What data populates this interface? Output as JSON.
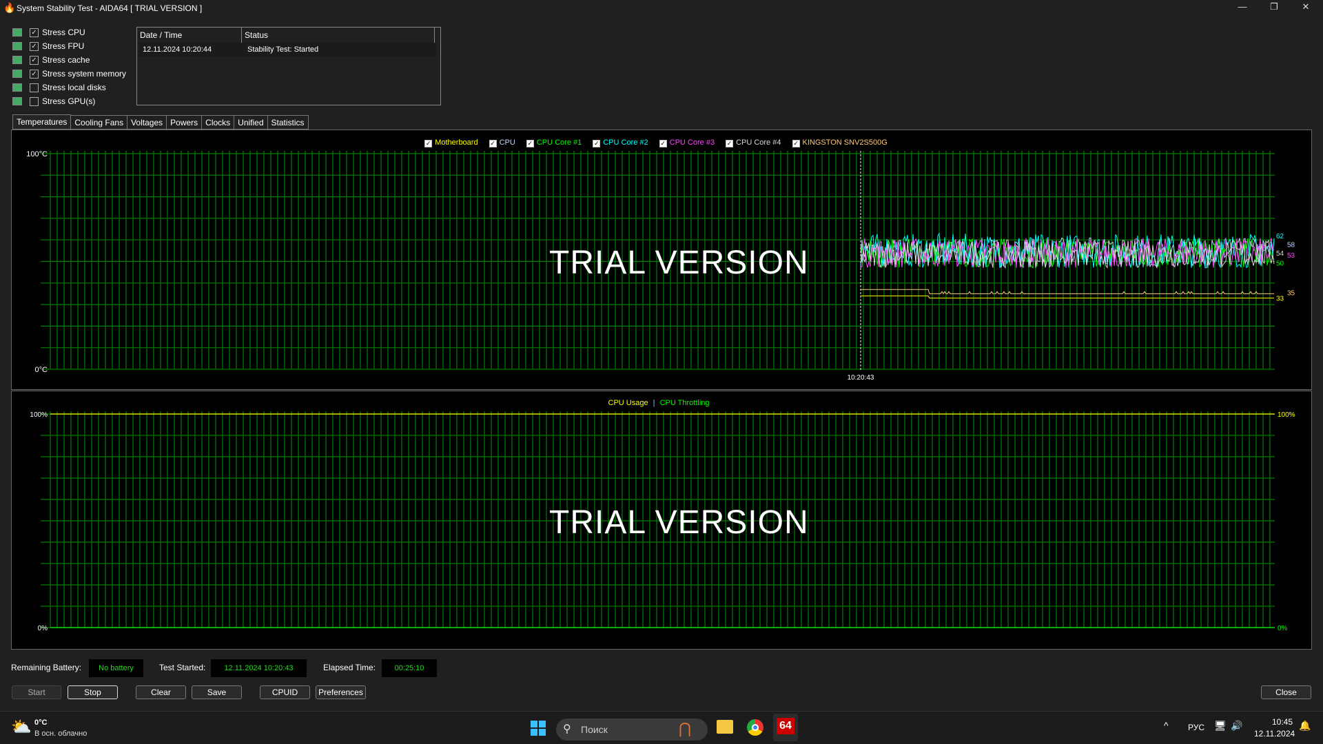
{
  "window": {
    "title": "System Stability Test - AIDA64  [ TRIAL VERSION ]"
  },
  "stress_options": [
    {
      "label": "Stress CPU",
      "checked": true,
      "icon": "cpu-icon"
    },
    {
      "label": "Stress FPU",
      "checked": true,
      "icon": "fpu-icon"
    },
    {
      "label": "Stress cache",
      "checked": true,
      "icon": "cache-chip-icon"
    },
    {
      "label": "Stress system memory",
      "checked": true,
      "icon": "memory-icon"
    },
    {
      "label": "Stress local disks",
      "checked": false,
      "icon": "disk-icon"
    },
    {
      "label": "Stress GPU(s)",
      "checked": false,
      "icon": "gpu-icon"
    }
  ],
  "log": {
    "headers": [
      "Date / Time",
      "Status"
    ],
    "rows": [
      {
        "datetime": "12.11.2024 10:20:44",
        "status": "Stability Test: Started"
      }
    ]
  },
  "tabs": [
    "Temperatures",
    "Cooling Fans",
    "Voltages",
    "Powers",
    "Clocks",
    "Unified",
    "Statistics"
  ],
  "active_tab": "Temperatures",
  "watermark": "TRIAL VERSION",
  "chart_data": [
    {
      "type": "line",
      "y_top_label": "100°C",
      "y_bottom_label": "0°C",
      "ylim": [
        0,
        100
      ],
      "x_tick_labels": [
        "10:20:43"
      ],
      "grid": true,
      "legend_placement": "top",
      "series": [
        {
          "name": "Motherboard",
          "color": "#ffff00",
          "checked": true,
          "current": 33,
          "range": [
            32,
            34
          ]
        },
        {
          "name": "CPU",
          "color": "#c0d8ff",
          "checked": true,
          "current": 58,
          "range": [
            47,
            61
          ]
        },
        {
          "name": "CPU Core #1",
          "color": "#00ff00",
          "checked": true,
          "current": 50,
          "range": [
            47,
            61
          ]
        },
        {
          "name": "CPU Core #2",
          "color": "#00ffff",
          "checked": true,
          "current": 62,
          "range": [
            47,
            63
          ]
        },
        {
          "name": "CPU Core #3",
          "color": "#ff44ff",
          "checked": true,
          "current": 53,
          "range": [
            47,
            61
          ]
        },
        {
          "name": "CPU Core #4",
          "color": "#d8d8d8",
          "checked": true,
          "current": 54,
          "range": [
            47,
            60
          ]
        },
        {
          "name": "KINGSTON SNV2S500G",
          "color": "#ffcc77",
          "checked": true,
          "current": 35,
          "range": [
            35,
            37
          ]
        }
      ]
    },
    {
      "type": "line",
      "y_top_label": "100%",
      "y_bottom_label": "0%",
      "right_top_label": "100%",
      "right_bottom_label": "0%",
      "ylim": [
        0,
        100
      ],
      "grid": true,
      "legend_placement": "top",
      "series": [
        {
          "name": "CPU Usage",
          "color": "#ffff00",
          "current": 100
        },
        {
          "name": "CPU Throttling",
          "color": "#00ff00",
          "current": 0
        }
      ],
      "separator": "|"
    }
  ],
  "status": {
    "battery_label": "Remaining Battery:",
    "battery_value": "No battery",
    "started_label": "Test Started:",
    "started_value": "12.11.2024 10:20:43",
    "elapsed_label": "Elapsed Time:",
    "elapsed_value": "00:25:10"
  },
  "buttons": {
    "start": "Start",
    "stop": "Stop",
    "clear": "Clear",
    "save": "Save",
    "cpuid": "CPUID",
    "preferences": "Preferences",
    "close": "Close"
  },
  "taskbar": {
    "weather_temp": "0°C",
    "weather_desc": "В осн. облачно",
    "search_placeholder": "Поиск",
    "lang": "РУС",
    "time": "10:45",
    "date": "12.11.2024",
    "aida_label": "64"
  }
}
